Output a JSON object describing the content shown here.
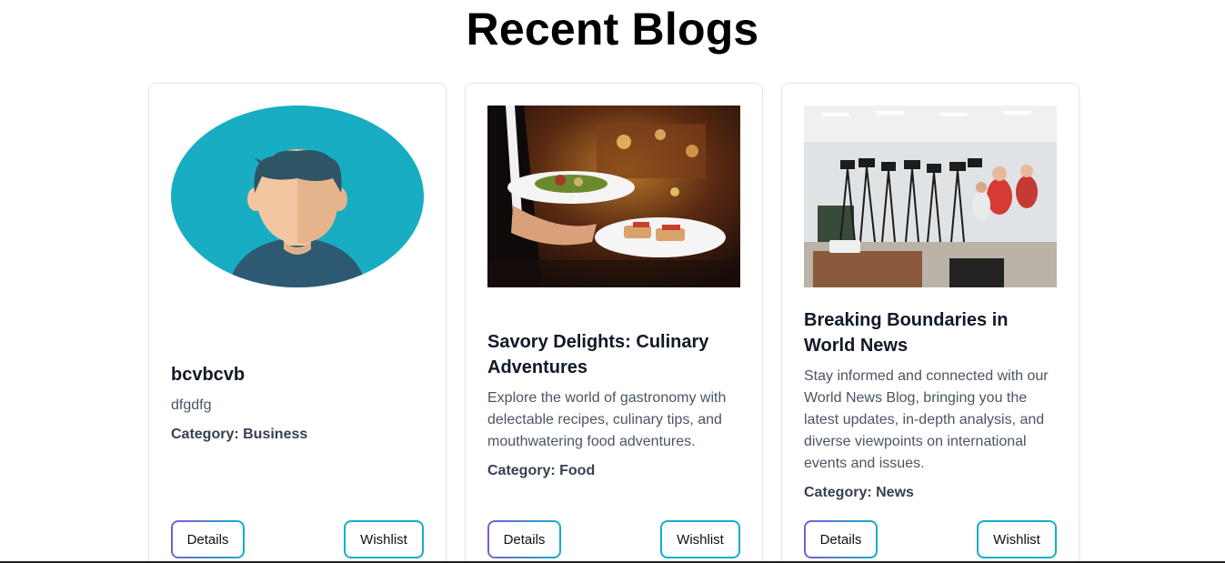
{
  "header": {
    "title": "Recent Blogs"
  },
  "cards": [
    {
      "image": "avatar-illustration",
      "title": "bcvbcvb",
      "description": "dfgdfg",
      "category": "Category: Business",
      "details_label": "Details",
      "wishlist_label": "Wishlist"
    },
    {
      "image": "restaurant-food-photo",
      "title": "Savory Delights: Culinary Adventures",
      "description": "Explore the world of gastronomy with delectable recipes, culinary tips, and mouthwatering food adventures.",
      "category": "Category: Food",
      "details_label": "Details",
      "wishlist_label": "Wishlist"
    },
    {
      "image": "press-conference-photo",
      "title": "Breaking Boundaries in World News",
      "description": "Stay informed and connected with our World News Blog, bringing you the latest updates, in-depth analysis, and diverse viewpoints on international events and issues.",
      "category": "Category: News",
      "details_label": "Details",
      "wishlist_label": "Wishlist"
    }
  ],
  "colors": {
    "accent_cyan": "#13aecb",
    "accent_purple": "#7c5cd6",
    "avatar_bg": "#18adc2",
    "avatar_shirt": "#2d5a72",
    "avatar_hair": "#2d5566",
    "avatar_skin": "#f2c6a0"
  }
}
